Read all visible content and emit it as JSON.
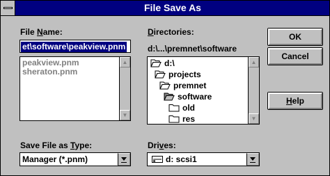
{
  "dialog": {
    "title": "File Save As"
  },
  "file_name": {
    "label_prefix": "File ",
    "label_key": "N",
    "label_suffix": "ame:",
    "value": "et\\software\\peakview.pnm",
    "files": [
      "peakview.pnm",
      "sheraton.pnm"
    ]
  },
  "directories": {
    "label_key": "D",
    "label_suffix": "irectories:",
    "current_path": "d:\\...\\premnet\\software",
    "items": [
      "d:\\",
      "projects",
      "premnet",
      "software",
      "old",
      "res"
    ]
  },
  "save_type": {
    "label_prefix": "Save File as ",
    "label_key": "T",
    "label_suffix": "ype:",
    "value": "Manager (*.pnm)"
  },
  "drives": {
    "label_prefix": "Dri",
    "label_key": "v",
    "label_suffix": "es:",
    "value": "d: scsi1"
  },
  "buttons": {
    "ok": "OK",
    "cancel": "Cancel",
    "help_key": "H",
    "help_suffix": "elp"
  }
}
